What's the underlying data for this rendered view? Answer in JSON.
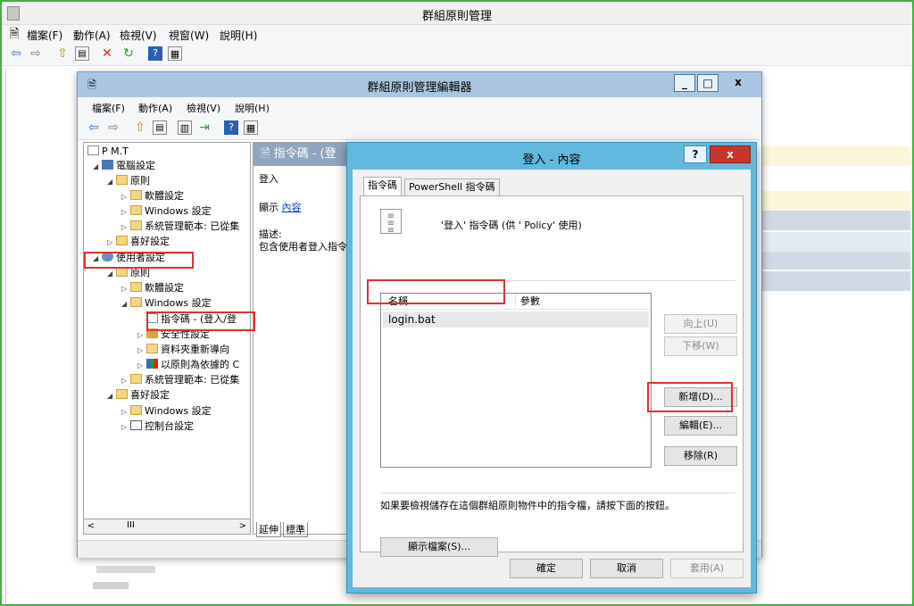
{
  "gpm": {
    "title": "群組原則管理",
    "menu": [
      "檔案(F)",
      "動作(A)",
      "檢視(V)",
      "視窗(W)",
      "說明(H)"
    ]
  },
  "editor": {
    "title": "群組原則管理編輯器",
    "menu": [
      "檔案(F)",
      "動作(A)",
      "檢視(V)",
      "說明(H)"
    ],
    "tree": [
      {
        "label": "P                                    M.T",
        "level": 0,
        "expand": "",
        "icon": "doc"
      },
      {
        "label": "電腦設定",
        "level": 1,
        "expand": "◢",
        "icon": "computer"
      },
      {
        "label": "原則",
        "level": 2,
        "expand": "◢",
        "icon": "folder"
      },
      {
        "label": "軟體設定",
        "level": 3,
        "expand": "▷",
        "icon": "folder"
      },
      {
        "label": "Windows 設定",
        "level": 3,
        "expand": "▷",
        "icon": "folder"
      },
      {
        "label": "系統管理範本: 已從集",
        "level": 3,
        "expand": "▷",
        "icon": "folder"
      },
      {
        "label": "喜好設定",
        "level": 2,
        "expand": "▷",
        "icon": "folder"
      },
      {
        "label": "使用者設定",
        "level": 1,
        "expand": "◢",
        "icon": "users"
      },
      {
        "label": "原則",
        "level": 2,
        "expand": "◢",
        "icon": "folder"
      },
      {
        "label": "軟體設定",
        "level": 3,
        "expand": "▷",
        "icon": "folder"
      },
      {
        "label": "Windows 設定",
        "level": 3,
        "expand": "◢",
        "icon": "folder"
      },
      {
        "label": "指令碼 - (登入/登",
        "level": 4,
        "expand": "",
        "icon": "doc"
      },
      {
        "label": "安全性設定",
        "level": 4,
        "expand": "▷",
        "icon": "security"
      },
      {
        "label": "資料夾重新導向",
        "level": 4,
        "expand": "▷",
        "icon": "folder"
      },
      {
        "label": "以原則為依據的 C",
        "level": 4,
        "expand": "▷",
        "icon": "chart"
      },
      {
        "label": "系統管理範本: 已從集",
        "level": 3,
        "expand": "▷",
        "icon": "folder"
      },
      {
        "label": "喜好設定",
        "level": 2,
        "expand": "◢",
        "icon": "folder"
      },
      {
        "label": "Windows 設定",
        "level": 3,
        "expand": "▷",
        "icon": "folder"
      },
      {
        "label": "控制台設定",
        "level": 3,
        "expand": "▷",
        "icon": "control"
      }
    ],
    "scroll_mark": "III",
    "mid_title": "指令碼 - (登",
    "mid_login": "登入",
    "mid_display_label": "顯示",
    "mid_display_link": "內容",
    "mid_desc_label": "描述:",
    "mid_desc": "包含使用者登入指令",
    "tab_extend": "延伸",
    "tab_standard": "標準"
  },
  "dialog": {
    "title": "登入 - 內容",
    "help": "?",
    "close": "x",
    "tabs": [
      "指令碼",
      "PowerShell 指令碼"
    ],
    "heading": "'登入' 指令碼 (供 '      Policy' 使用)",
    "columns": [
      "名稱",
      "參數"
    ],
    "rows": [
      {
        "name": "login.bat",
        "params": ""
      }
    ],
    "buttons": {
      "up": "向上(U)",
      "down": "下移(W)",
      "add": "新增(D)...",
      "edit": "編輯(E)...",
      "remove": "移除(R)",
      "show_files": "顯示檔案(S)...",
      "ok": "確定",
      "cancel": "取消",
      "apply": "套用(A)"
    },
    "note": "如果要檢視儲存在這個群組原則物件中的指令檔，請按下面的按鈕。"
  },
  "colors": {
    "highlight": "#e03030",
    "dialog_frame": "#63b9dd",
    "editor_title": "#a9c7e3",
    "frame_border": "#3fb33f"
  }
}
